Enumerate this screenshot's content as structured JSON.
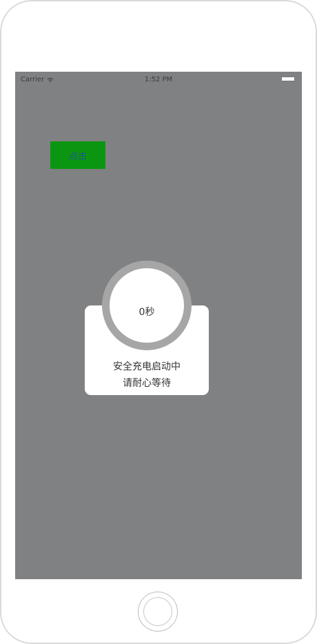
{
  "status_bar": {
    "carrier": "Carrier",
    "time": "1:52 PM",
    "wifi_icon": "wifi-icon",
    "battery_icon": "battery-icon"
  },
  "main": {
    "click_button_label": "点击"
  },
  "dialog": {
    "countdown": "0秒",
    "line1": "安全充电启动中",
    "line2": "请耐心等待"
  },
  "colors": {
    "screen_background": "#808182",
    "button_background": "#0b9612",
    "button_text": "#1d5a88",
    "ring": "#a6a6a6"
  }
}
